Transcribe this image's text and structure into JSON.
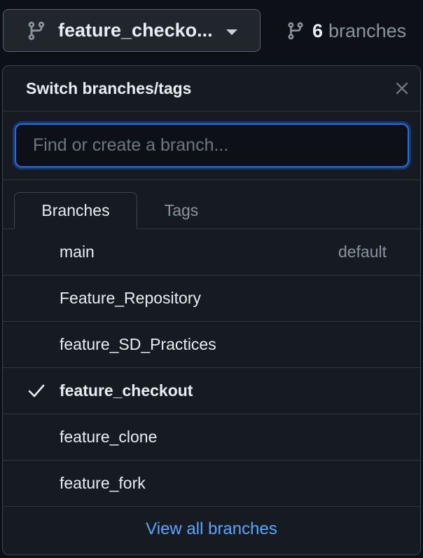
{
  "current_branch_button": {
    "label": "feature_checko...",
    "icon": "git-branch-icon"
  },
  "branch_count": {
    "count": "6",
    "label": "branches",
    "icon": "git-branch-icon"
  },
  "dropdown": {
    "title": "Switch branches/tags",
    "close_icon": "close-icon",
    "search": {
      "placeholder": "Find or create a branch...",
      "value": ""
    },
    "tabs": [
      {
        "label": "Branches",
        "active": true
      },
      {
        "label": "Tags",
        "active": false
      }
    ],
    "branches": [
      {
        "name": "main",
        "badge": "default",
        "selected": false
      },
      {
        "name": "Feature_Repository",
        "badge": "",
        "selected": false
      },
      {
        "name": "feature_SD_Practices",
        "badge": "",
        "selected": false
      },
      {
        "name": "feature_checkout",
        "badge": "",
        "selected": true
      },
      {
        "name": "feature_clone",
        "badge": "",
        "selected": false
      },
      {
        "name": "feature_fork",
        "badge": "",
        "selected": false
      }
    ],
    "view_all_label": "View all branches"
  },
  "colors": {
    "background": "#0d1117",
    "panel": "#161b22",
    "border": "#30363d",
    "accent_link": "#58a6ff",
    "focus_ring": "#1f6feb",
    "muted_text": "#8b949e"
  }
}
